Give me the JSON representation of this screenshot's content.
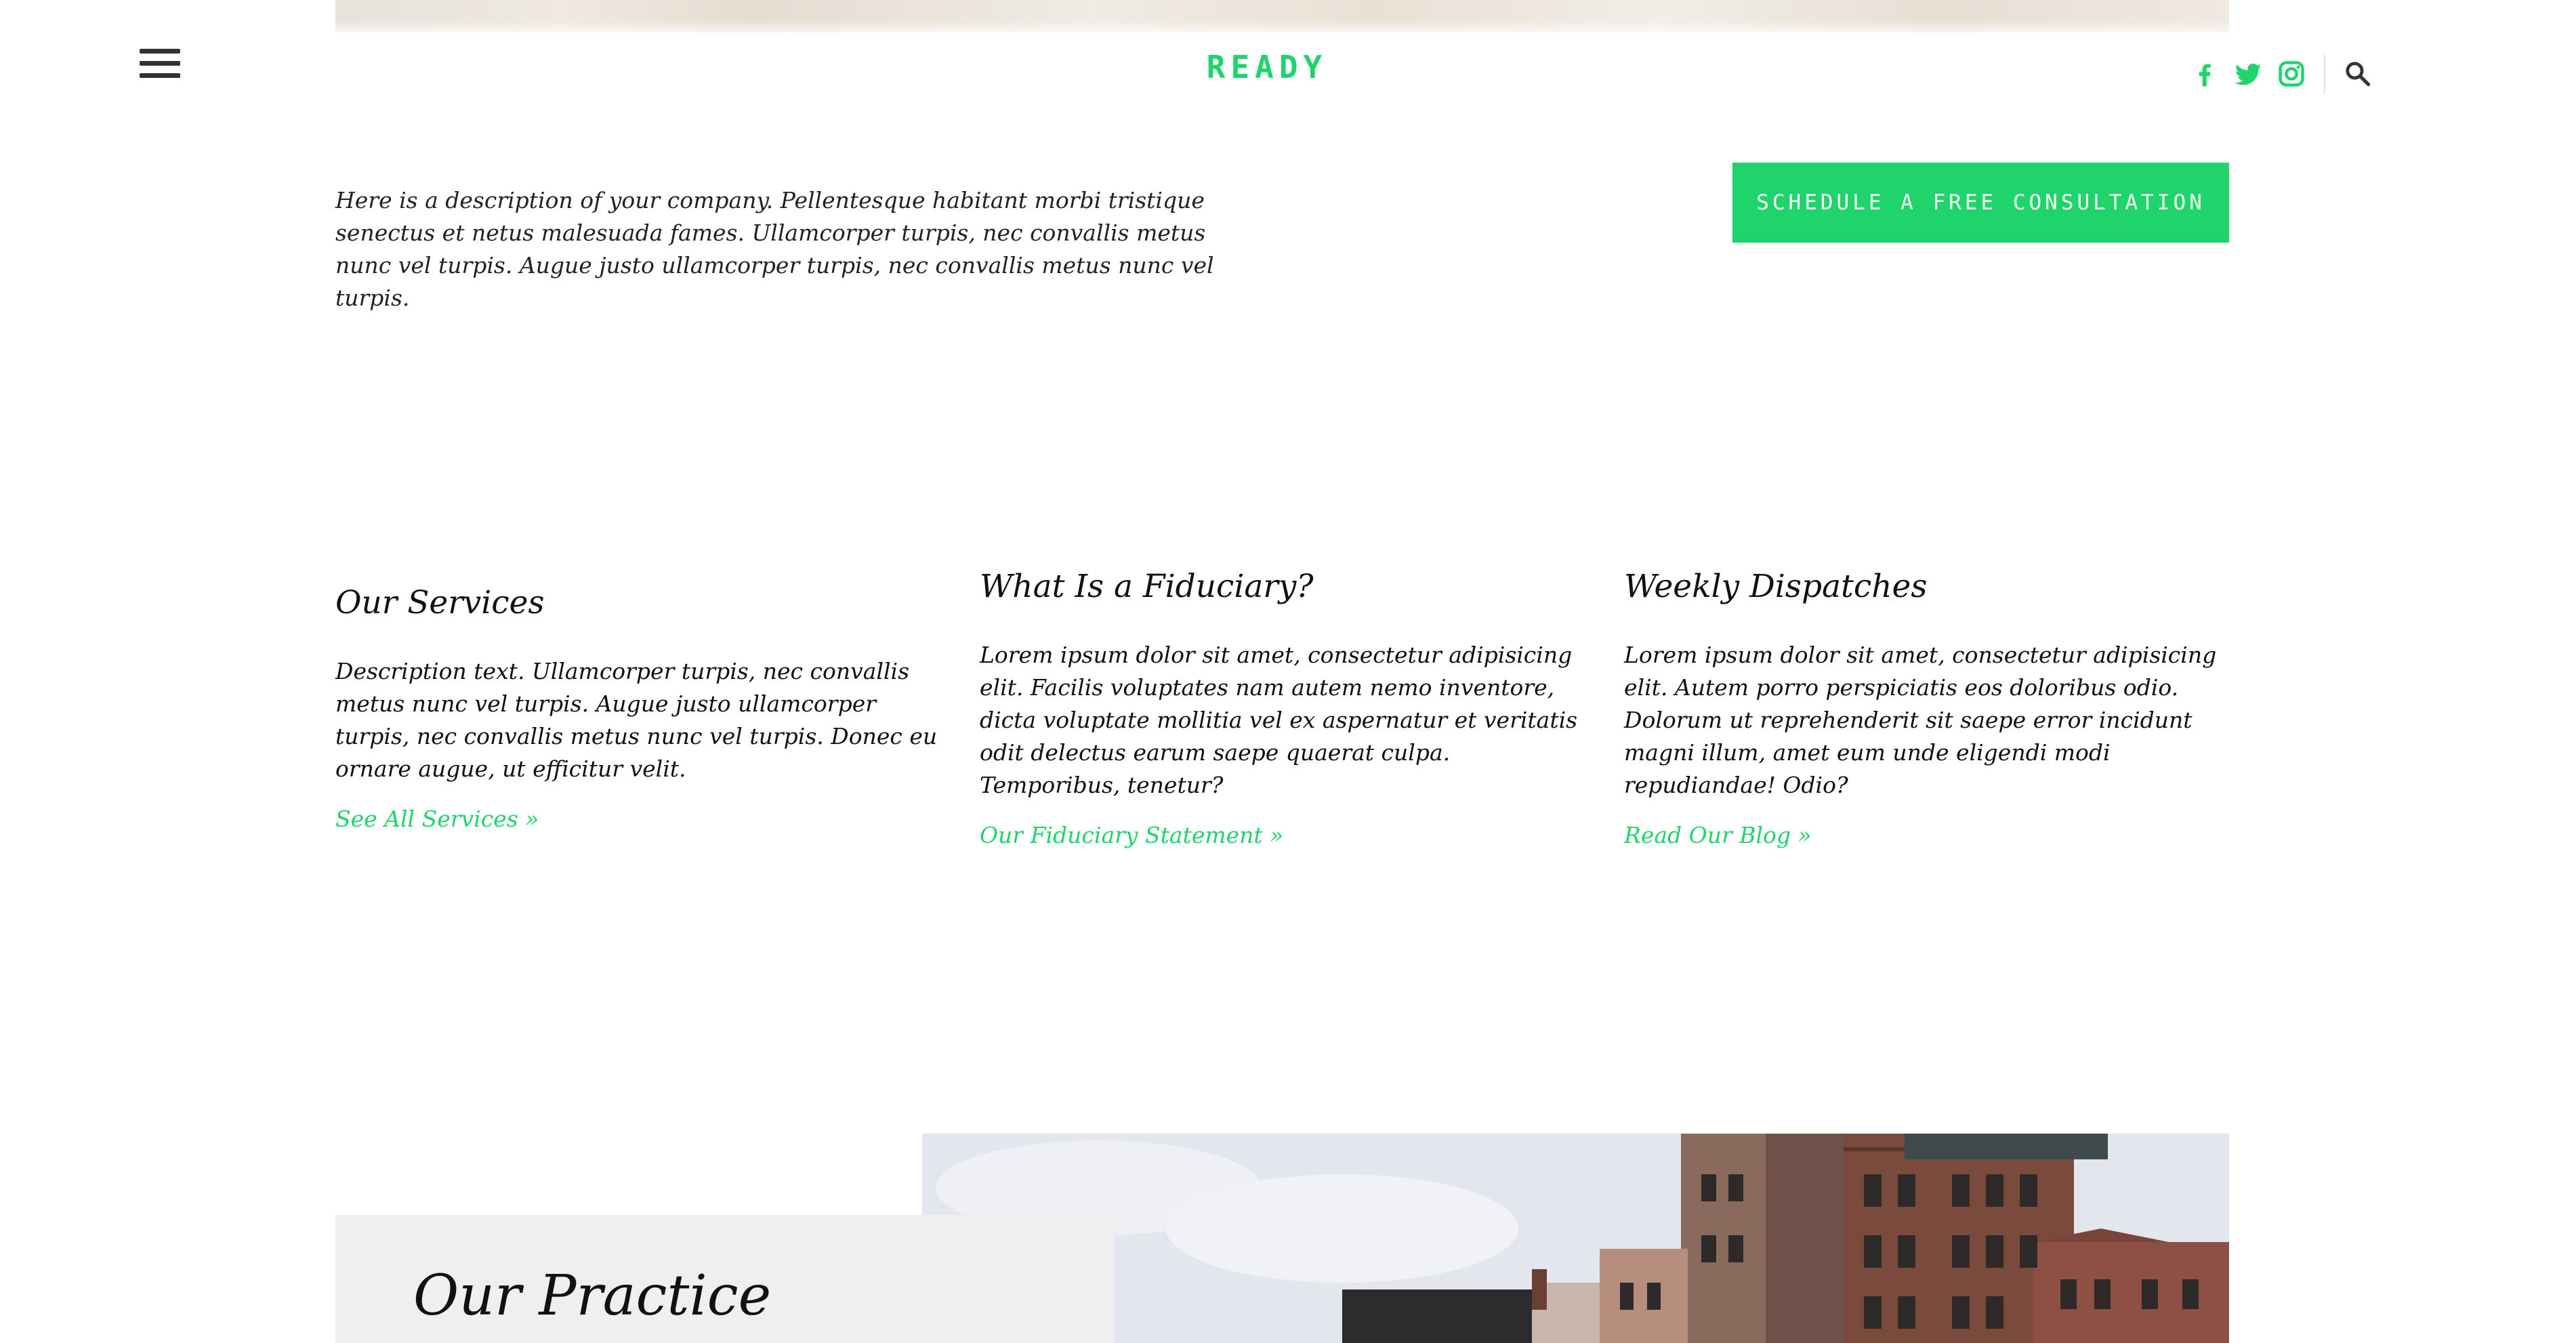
{
  "header": {
    "logo": "READY",
    "menu_icon": "hamburger-menu-icon",
    "social": [
      "facebook-icon",
      "twitter-icon",
      "instagram-icon"
    ],
    "search_icon": "search-icon"
  },
  "intro": {
    "description": "Here is a description of your company.  Pellentesque habitant morbi tristique senectus et netus malesuada fames. Ullamcorper turpis, nec convallis metus nunc vel turpis. Augue justo ullamcorper turpis, nec convallis metus nunc vel turpis.",
    "cta_label": "SCHEDULE A FREE CONSULTATION"
  },
  "columns": [
    {
      "title": "Our Services",
      "text": "Description text. Ullamcorper turpis, nec convallis metus nunc vel turpis. Augue justo ullamcorper turpis, nec convallis metus nunc vel turpis. Donec eu ornare augue, ut efficitur velit.",
      "link": "See All Services »"
    },
    {
      "title": "What Is a Fiduciary?",
      "text": "Lorem ipsum dolor sit amet, consectetur adipisicing elit. Facilis voluptates nam autem nemo inventore, dicta voluptate mollitia vel ex aspernatur et veritatis odit delectus earum saepe quaerat culpa. Temporibus, tenetur?",
      "link": "Our Fiduciary Statement »"
    },
    {
      "title": "Weekly Dispatches",
      "text": "Lorem ipsum dolor sit amet, consectetur adipisicing elit. Autem porro perspiciatis eos doloribus odio. Dolorum ut reprehenderit sit saepe error incidunt magni illum, amet eum unde eligendi modi repudiandae! Odio?",
      "link": "Read Our Blog »"
    }
  ],
  "practice": {
    "title": "Our Practice"
  },
  "colors": {
    "accent": "#1fd56b",
    "text": "#111111",
    "card_bg": "#efefef"
  }
}
